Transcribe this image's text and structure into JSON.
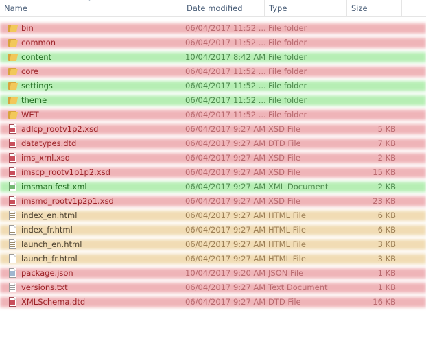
{
  "columns": {
    "name": "Name",
    "date": "Date modified",
    "type": "Type",
    "size": "Size"
  },
  "files": [
    {
      "name": "bin",
      "date": "06/04/2017 11:52 ...",
      "type": "File folder",
      "size": "",
      "highlight": "red",
      "icon": "folder-icon"
    },
    {
      "name": "common",
      "date": "06/04/2017 11:52 ...",
      "type": "File folder",
      "size": "",
      "highlight": "red",
      "icon": "folder-icon"
    },
    {
      "name": "content",
      "date": "10/04/2017 8:42 AM",
      "type": "File folder",
      "size": "",
      "highlight": "green",
      "icon": "folder-icon"
    },
    {
      "name": "core",
      "date": "06/04/2017 11:52 ...",
      "type": "File folder",
      "size": "",
      "highlight": "red",
      "icon": "folder-icon"
    },
    {
      "name": "settings",
      "date": "06/04/2017 11:52 ...",
      "type": "File folder",
      "size": "",
      "highlight": "green",
      "icon": "folder-icon"
    },
    {
      "name": "theme",
      "date": "06/04/2017 11:52 ...",
      "type": "File folder",
      "size": "",
      "highlight": "green",
      "icon": "folder-icon"
    },
    {
      "name": "WET",
      "date": "06/04/2017 11:52 ...",
      "type": "File folder",
      "size": "",
      "highlight": "red",
      "icon": "folder-icon"
    },
    {
      "name": "adlcp_rootv1p2.xsd",
      "date": "06/04/2017 9:27 AM",
      "type": "XSD File",
      "size": "5 KB",
      "highlight": "red",
      "icon": "xsd-file-icon"
    },
    {
      "name": "datatypes.dtd",
      "date": "06/04/2017 9:27 AM",
      "type": "DTD File",
      "size": "7 KB",
      "highlight": "red",
      "icon": "dtd-file-icon"
    },
    {
      "name": "ims_xml.xsd",
      "date": "06/04/2017 9:27 AM",
      "type": "XSD File",
      "size": "2 KB",
      "highlight": "red",
      "icon": "xsd-file-icon"
    },
    {
      "name": "imscp_rootv1p1p2.xsd",
      "date": "06/04/2017 9:27 AM",
      "type": "XSD File",
      "size": "15 KB",
      "highlight": "red",
      "icon": "xsd-file-icon"
    },
    {
      "name": "imsmanifest.xml",
      "date": "06/04/2017 9:27 AM",
      "type": "XML Document",
      "size": "2 KB",
      "highlight": "green",
      "icon": "xml-file-icon"
    },
    {
      "name": "imsmd_rootv1p2p1.xsd",
      "date": "06/04/2017 9:27 AM",
      "type": "XSD File",
      "size": "23 KB",
      "highlight": "red",
      "icon": "xsd-file-icon"
    },
    {
      "name": "index_en.html",
      "date": "06/04/2017 9:27 AM",
      "type": "HTML File",
      "size": "6 KB",
      "highlight": "amber",
      "icon": "html-file-icon"
    },
    {
      "name": "index_fr.html",
      "date": "06/04/2017 9:27 AM",
      "type": "HTML File",
      "size": "6 KB",
      "highlight": "amber",
      "icon": "html-file-icon"
    },
    {
      "name": "launch_en.html",
      "date": "06/04/2017 9:27 AM",
      "type": "HTML File",
      "size": "3 KB",
      "highlight": "amber",
      "icon": "html-file-icon"
    },
    {
      "name": "launch_fr.html",
      "date": "06/04/2017 9:27 AM",
      "type": "HTML File",
      "size": "3 KB",
      "highlight": "amber",
      "icon": "html-file-icon"
    },
    {
      "name": "package.json",
      "date": "10/04/2017 9:20 AM",
      "type": "JSON File",
      "size": "1 KB",
      "highlight": "red",
      "icon": "json-file-icon"
    },
    {
      "name": "versions.txt",
      "date": "06/04/2017 9:27 AM",
      "type": "Text Document",
      "size": "1 KB",
      "highlight": "red",
      "icon": "txt-file-icon"
    },
    {
      "name": "XMLSchema.dtd",
      "date": "06/04/2017 9:27 AM",
      "type": "DTD File",
      "size": "16 KB",
      "highlight": "red",
      "icon": "dtd-file-icon"
    }
  ],
  "colors": {
    "red": "#efb4b8",
    "green": "#b6eeb4",
    "amber": "#f1dcb4"
  }
}
